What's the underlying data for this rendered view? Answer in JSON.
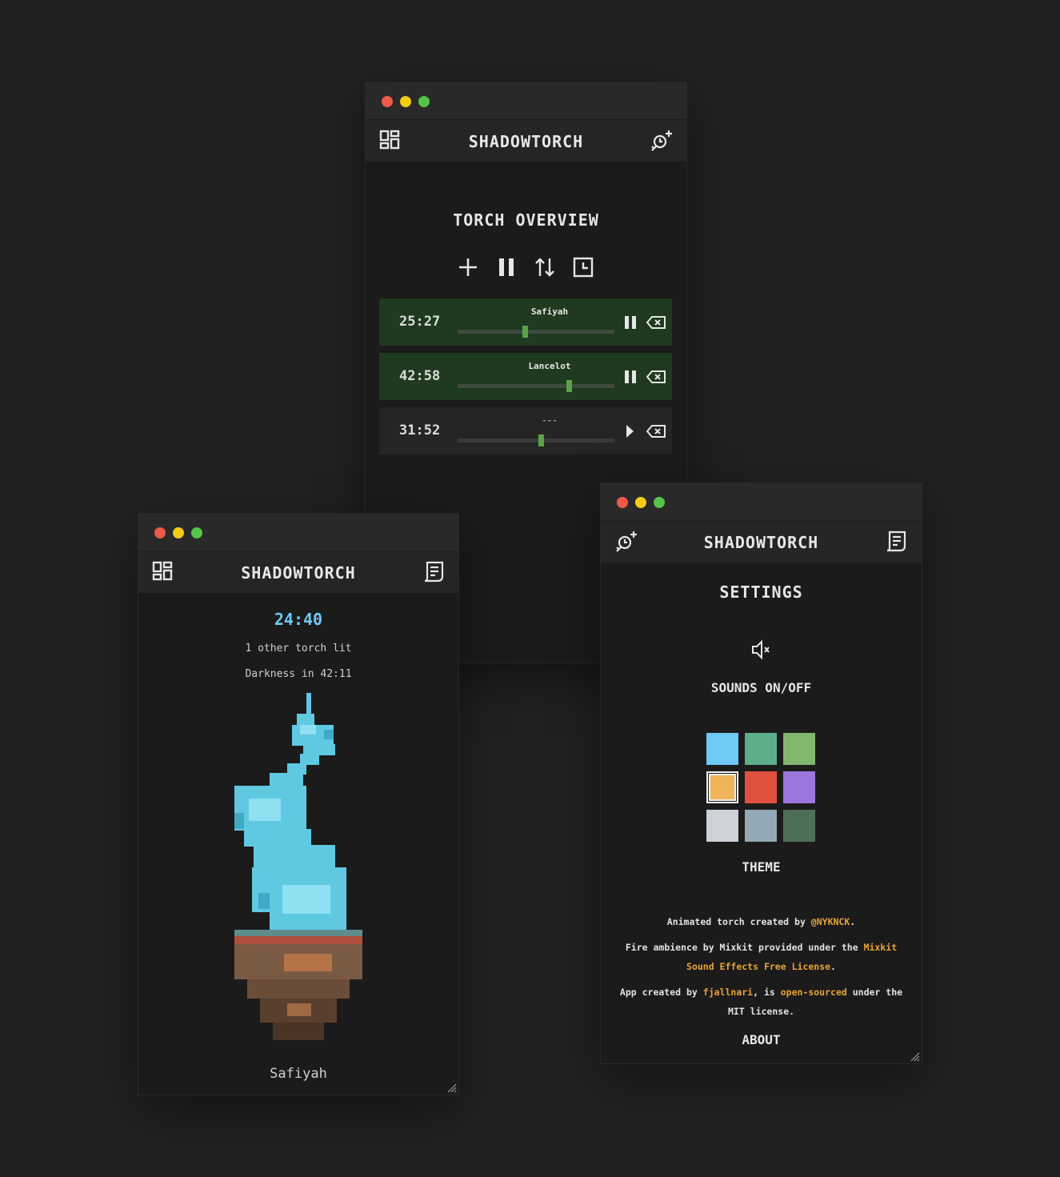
{
  "overview_window": {
    "app_title": "SHADOWTORCH",
    "heading": "TORCH OVERVIEW",
    "toolbar": {
      "add_icon": "plus-icon",
      "pause_icon": "pause-icon",
      "sort_icon": "sort-icon",
      "history_icon": "clock-icon"
    },
    "torches": [
      {
        "time": "25:27",
        "name": "Safiyah",
        "state": "running",
        "progress": 0.43
      },
      {
        "time": "42:58",
        "name": "Lancelot",
        "state": "running",
        "progress": 0.71
      },
      {
        "time": "31:52",
        "name": "---",
        "state": "paused",
        "progress": 0.53
      }
    ]
  },
  "torch_window": {
    "app_title": "SHADOWTORCH",
    "timer": "24:40",
    "other_torches": "1 other torch lit",
    "darkness": "Darkness in 42:11",
    "torch_name": "Safiyah",
    "flame_color": "#6fd3ea"
  },
  "settings_window": {
    "app_title": "SHADOWTORCH",
    "heading": "SETTINGS",
    "sound_icon": "speaker-muted-icon",
    "sounds_label": "SOUNDS ON/OFF",
    "theme_label": "THEME",
    "themes": [
      "#6ec9f4",
      "#5daf8c",
      "#82b86e",
      "#efb35a",
      "#e0523f",
      "#9a78dc",
      "#cdd2d9",
      "#93a9b7",
      "#4f6e58"
    ],
    "selected_theme": 3,
    "about": {
      "l1a": "Animated torch created by ",
      "l1_link": "@NYKNCK",
      "l1b": ".",
      "l2a": "Fire ambience by Mixkit provided under the ",
      "l2_link": "Mixkit Sound Effects Free License",
      "l2b": ".",
      "l3a": "App created by ",
      "l3_link1": "fjallnari",
      "l3b": ", is ",
      "l3_link2": "open-sourced",
      "l3c": " under the MIT license."
    },
    "about_label": "ABOUT"
  }
}
